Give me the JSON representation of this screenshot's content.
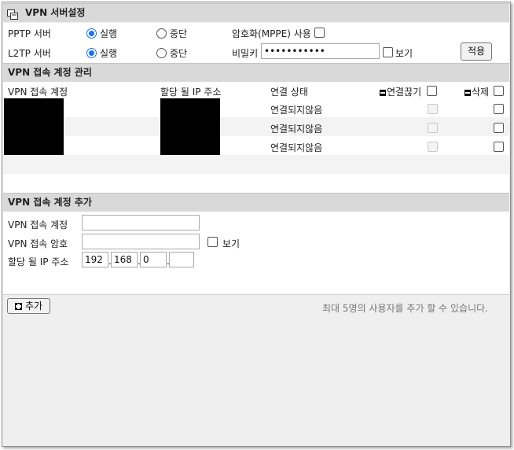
{
  "server_settings": {
    "title": "VPN 서버설정",
    "pptp": {
      "label": "PPTP 서버",
      "run_label": "실행",
      "stop_label": "중단",
      "selected": "run"
    },
    "l2tp": {
      "label": "L2TP 서버",
      "run_label": "실행",
      "stop_label": "중단",
      "selected": "run"
    },
    "mppe_label": "암호화(MPPE) 사용",
    "mppe_checked": false,
    "secret_label": "비밀키",
    "secret_value": "•••••••••••",
    "show_label": "보기",
    "apply_label": "적용"
  },
  "account_mgmt": {
    "title": "VPN 접속 계정 관리",
    "col_account": "VPN 접속 계정",
    "col_ip": "할당 될 IP 주소",
    "col_status": "연결 상태",
    "col_disconnect": "연결끊기",
    "col_delete": "삭제",
    "rows": [
      {
        "status": "연결되지않음"
      },
      {
        "status": "연결되지않음"
      },
      {
        "status": "연결되지않음"
      }
    ]
  },
  "add_account": {
    "title": "VPN 접속 계정 추가",
    "account_label": "VPN 접속 계정",
    "account_value": "",
    "password_label": "VPN 접속 암호",
    "password_value": "",
    "show_label": "보기",
    "ip_label": "할당 될 IP 주소",
    "ip": [
      "192",
      "168",
      "0",
      ""
    ],
    "add_label": "추가",
    "limit_note": "최대 5명의 사용자를 추가 할 수 있습니다."
  },
  "colors": {
    "section_bar": "#d9d9d9",
    "radio_active": "#1a73e8",
    "note_text": "#777777"
  }
}
